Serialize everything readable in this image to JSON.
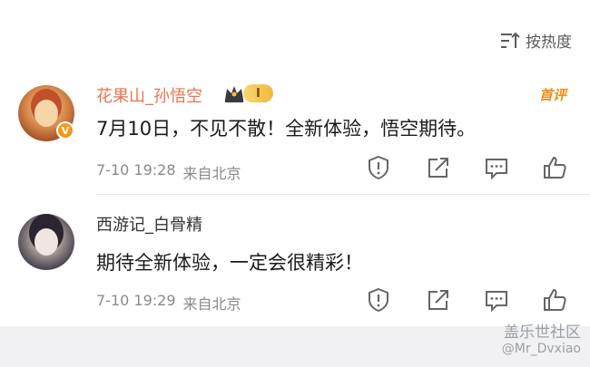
{
  "sort": {
    "label": "按热度",
    "icon": "sort-icon"
  },
  "comments": [
    {
      "username": "花果山_孙悟空",
      "rank_level": "I",
      "tag": "首评",
      "text": "7月10日，不见不散！全新体验，悟空期待。",
      "date": "7-10 19:28",
      "location": "来自北京",
      "verified": "V"
    },
    {
      "username": "西游记_白骨精",
      "text": "期待全新体验，一定会很精彩！",
      "date": "7-10 19:29",
      "location": "来自北京"
    }
  ],
  "actions": [
    "report-icon",
    "share-icon",
    "comment-icon",
    "like-icon"
  ],
  "watermark": {
    "brand": "盖乐世社区",
    "user": "@Mr_Dvxiao"
  },
  "colors": {
    "username_highlight": "#eb7350",
    "first_tag": "#f28c1a",
    "meta": "#8a8a8a"
  }
}
